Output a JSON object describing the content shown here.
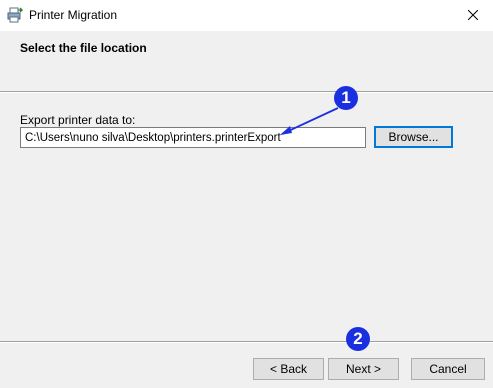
{
  "window": {
    "title": "Printer Migration"
  },
  "header": {
    "title": "Select the file location"
  },
  "export": {
    "label": "Export printer data to:",
    "path_value": "C:\\Users\\nuno silva\\Desktop\\printers.printerExport",
    "browse_label": "Browse..."
  },
  "footer": {
    "back_label": "< Back",
    "next_label": "Next >",
    "cancel_label": "Cancel"
  },
  "annotations": {
    "step1": "1",
    "step2": "2"
  },
  "colors": {
    "badge": "#1a30e0",
    "focus": "#0078d7",
    "background": "#f0f0f0"
  },
  "icons": {
    "app": "printer-migration-icon",
    "close": "close-icon"
  }
}
